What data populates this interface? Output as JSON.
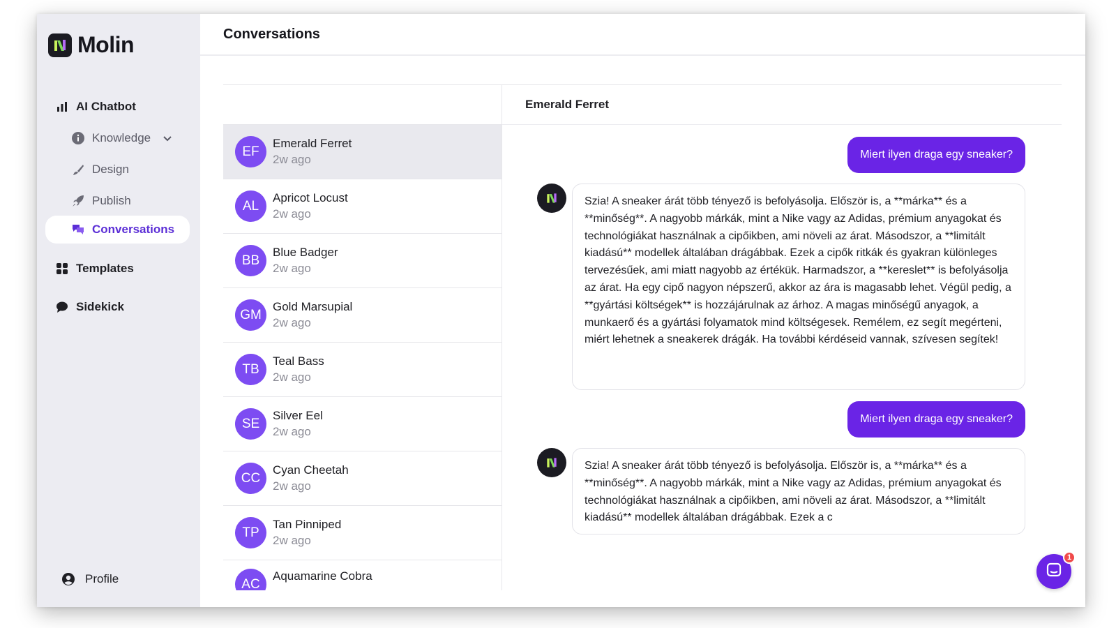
{
  "app": {
    "name": "Molin"
  },
  "sidebar": {
    "items": [
      {
        "label": "AI Chatbot",
        "icon": "bar-chart-icon"
      },
      {
        "label": "Knowledge",
        "icon": "info-icon"
      },
      {
        "label": "Design",
        "icon": "brush-icon"
      },
      {
        "label": "Publish",
        "icon": "rocket-icon"
      },
      {
        "label": "Conversations",
        "icon": "chat-bubbles-icon",
        "active": true
      },
      {
        "label": "Templates",
        "icon": "grid-icon"
      },
      {
        "label": "Sidekick",
        "icon": "speech-bubble-icon"
      }
    ],
    "profile_label": "Profile"
  },
  "page": {
    "title": "Conversations"
  },
  "conversations": [
    {
      "initials": "EF",
      "name": "Emerald Ferret",
      "time": "2w ago"
    },
    {
      "initials": "AL",
      "name": "Apricot Locust",
      "time": "2w ago"
    },
    {
      "initials": "BB",
      "name": "Blue Badger",
      "time": "2w ago"
    },
    {
      "initials": "GM",
      "name": "Gold Marsupial",
      "time": "2w ago"
    },
    {
      "initials": "TB",
      "name": "Teal Bass",
      "time": "2w ago"
    },
    {
      "initials": "SE",
      "name": "Silver Eel",
      "time": "2w ago"
    },
    {
      "initials": "CC",
      "name": "Cyan Cheetah",
      "time": "2w ago"
    },
    {
      "initials": "TP",
      "name": "Tan Pinniped",
      "time": "2w ago"
    },
    {
      "initials": "AC",
      "name": "Aquamarine Cobra",
      "time": ""
    }
  ],
  "chat": {
    "title": "Emerald Ferret",
    "messages": [
      {
        "role": "user",
        "text": "Miert ilyen draga egy sneaker?"
      },
      {
        "role": "bot",
        "text": "Szia! A sneaker árát több tényező is befolyásolja. Először is, a **márka** és a **minőség**. A nagyobb márkák, mint a Nike vagy az Adidas, prémium anyagokat és technológiákat használnak a cipőikben, ami növeli az árat. Másodszor, a **limitált kiadású** modellek általában drágábbak. Ezek a cipők ritkák és gyakran különleges tervezésűek, ami miatt nagyobb az értékük. Harmadszor, a **kereslet** is befolyásolja az árat. Ha egy cipő nagyon népszerű, akkor az ára is magasabb lehet. Végül pedig, a **gyártási költségek** is hozzájárulnak az árhoz. A magas minőségű anyagok, a munkaerő és a gyártási folyamatok mind költségesek. Remélem, ez segít megérteni, miért lehetnek a sneakerek drágák. Ha további kérdéseid vannak, szívesen segítek!"
      },
      {
        "role": "user",
        "text": "Miert ilyen draga egy sneaker?"
      },
      {
        "role": "bot",
        "text": "Szia! A sneaker árát több tényező is befolyásolja. Először is, a **márka** és a **minőség**. A nagyobb márkák, mint a Nike vagy az Adidas, prémium anyagokat és technológiákat használnak a cipőikben, ami növeli az árat. Másodszor, a **limitált kiadású** modellek általában drágábbak. Ezek a c"
      }
    ]
  },
  "support": {
    "badge_count": "1",
    "icon": "chat-window-icon"
  },
  "colors": {
    "accent": "#6a24e6",
    "avatar": "#7d4cf2",
    "sidebar_bg": "#ececf2",
    "badge": "#f04a4a"
  }
}
